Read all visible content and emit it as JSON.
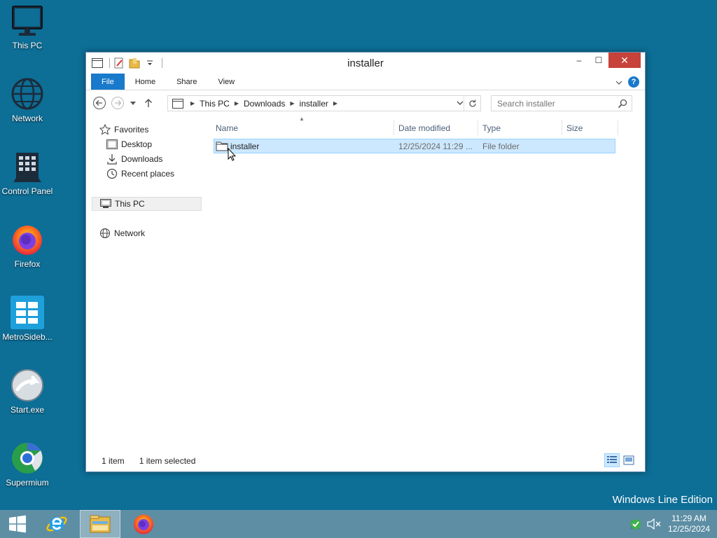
{
  "desktop": {
    "icons": [
      {
        "label": "This PC",
        "icon": "computer-icon"
      },
      {
        "label": "Network",
        "icon": "globe-icon"
      },
      {
        "label": "Control Panel",
        "icon": "control-panel-icon"
      },
      {
        "label": "Firefox",
        "icon": "firefox-icon"
      },
      {
        "label": "MetroSideb...",
        "icon": "metro-icon"
      },
      {
        "label": "Start.exe",
        "icon": "start-exe-icon"
      },
      {
        "label": "Supermium",
        "icon": "supermium-icon"
      }
    ],
    "watermark": "Windows Line Edition"
  },
  "window": {
    "title": "installer",
    "controls": {
      "minimize": "–",
      "maximize": "☐",
      "close": "✕"
    }
  },
  "ribbon": {
    "tabs": [
      {
        "label": "File",
        "active": true
      },
      {
        "label": "Home"
      },
      {
        "label": "Share"
      },
      {
        "label": "View"
      }
    ],
    "help": "?"
  },
  "navigation": {
    "breadcrumb": [
      "This PC",
      "Downloads",
      "installer"
    ],
    "search_placeholder": "Search installer"
  },
  "nav_pane": {
    "favorites_label": "Favorites",
    "favorites": [
      "Desktop",
      "Downloads",
      "Recent places"
    ],
    "this_pc": "This PC",
    "network": "Network"
  },
  "file_list": {
    "columns": [
      "Name",
      "Date modified",
      "Type",
      "Size"
    ],
    "rows": [
      {
        "name": "installer",
        "date_modified": "12/25/2024 11:29 ...",
        "type": "File folder",
        "size": "",
        "selected": true
      }
    ]
  },
  "status_bar": {
    "item_count": "1 item",
    "selection": "1 item selected"
  },
  "taskbar": {
    "items": [
      "start-button",
      "internet-explorer",
      "file-explorer",
      "firefox"
    ],
    "time": "11:29 AM",
    "date": "12/25/2024"
  },
  "colors": {
    "desktop": "#0d6e96",
    "accent": "#1979ca",
    "selection": "#cce8ff",
    "taskbar": "#5d8ea4",
    "close": "#c7423b"
  }
}
